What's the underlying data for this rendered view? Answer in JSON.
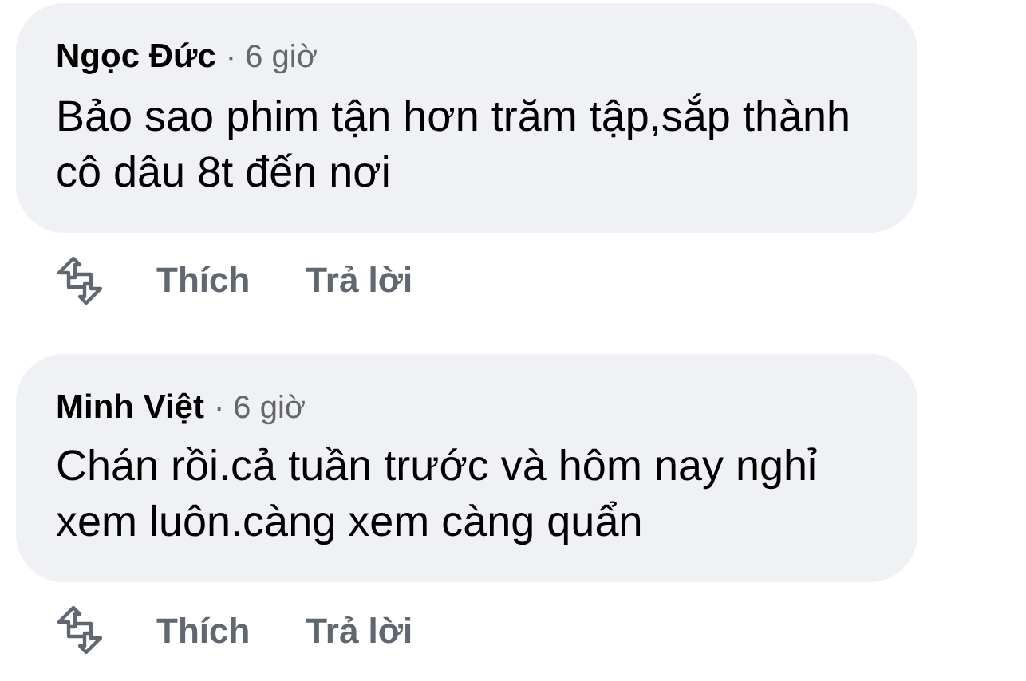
{
  "comments": [
    {
      "author": "Ngọc Đức",
      "time": "· 6 giờ",
      "text": "Bảo sao phim tận hơn trăm tập,sắp thành cô dâu 8t đến nơi",
      "actions": [
        "Thích",
        "Trả lời"
      ]
    },
    {
      "author": "Minh Việt",
      "time": "· 6 giờ",
      "text": "Chán rồi.cả tuần trước và hôm nay nghỉ xem luôn.càng xem càng quẩn",
      "actions": [
        "Thích",
        "Trả lời"
      ]
    }
  ]
}
